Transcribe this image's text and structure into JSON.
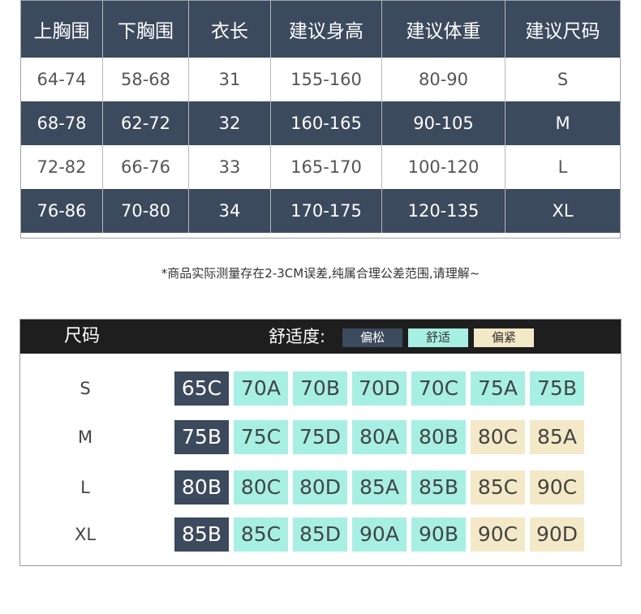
{
  "size_table": {
    "headers": [
      "上胸围",
      "下胸围",
      "衣长",
      "建议身高",
      "建议体重",
      "建议尺码"
    ],
    "rows": [
      [
        "64-74",
        "58-68",
        "31",
        "155-160",
        "80-90",
        "S"
      ],
      [
        "68-78",
        "62-72",
        "32",
        "160-165",
        "90-105",
        "M"
      ],
      [
        "72-82",
        "66-76",
        "33",
        "165-170",
        "100-120",
        "L"
      ],
      [
        "76-86",
        "70-80",
        "34",
        "170-175",
        "120-135",
        "XL"
      ]
    ]
  },
  "note": "*商品实际测量存在2-3CM误差,纯属合理公差范围,请理解~",
  "cup_chart": {
    "title": "尺码",
    "comfort_label": "舒适度:",
    "legend": {
      "loose": "偏松",
      "fit": "舒适",
      "tight": "偏紧"
    },
    "rows": [
      {
        "size": "S",
        "cells": [
          [
            "65C",
            "loose"
          ],
          [
            "70A",
            "fit"
          ],
          [
            "70B",
            "fit"
          ],
          [
            "70D",
            "fit"
          ],
          [
            "70C",
            "fit"
          ],
          [
            "75A",
            "fit"
          ],
          [
            "75B",
            "fit"
          ]
        ]
      },
      {
        "size": "M",
        "cells": [
          [
            "75B",
            "loose"
          ],
          [
            "75C",
            "fit"
          ],
          [
            "75D",
            "fit"
          ],
          [
            "80A",
            "fit"
          ],
          [
            "80B",
            "fit"
          ],
          [
            "80C",
            "tight"
          ],
          [
            "85A",
            "tight"
          ]
        ]
      },
      {
        "size": "L",
        "cells": [
          [
            "80B",
            "loose"
          ],
          [
            "80C",
            "fit"
          ],
          [
            "80D",
            "fit"
          ],
          [
            "85A",
            "fit"
          ],
          [
            "85B",
            "fit"
          ],
          [
            "85C",
            "tight"
          ],
          [
            "90C",
            "tight"
          ]
        ]
      },
      {
        "size": "XL",
        "cells": [
          [
            "85B",
            "loose"
          ],
          [
            "85C",
            "fit"
          ],
          [
            "85D",
            "fit"
          ],
          [
            "90A",
            "fit"
          ],
          [
            "90B",
            "fit"
          ],
          [
            "90C",
            "tight"
          ],
          [
            "90D",
            "tight"
          ]
        ]
      }
    ]
  },
  "colors": {
    "dark": "#3b4a5c",
    "fit": "#a6f0e3",
    "tight": "#f3e9c6",
    "header_black": "#1e1e1e"
  }
}
